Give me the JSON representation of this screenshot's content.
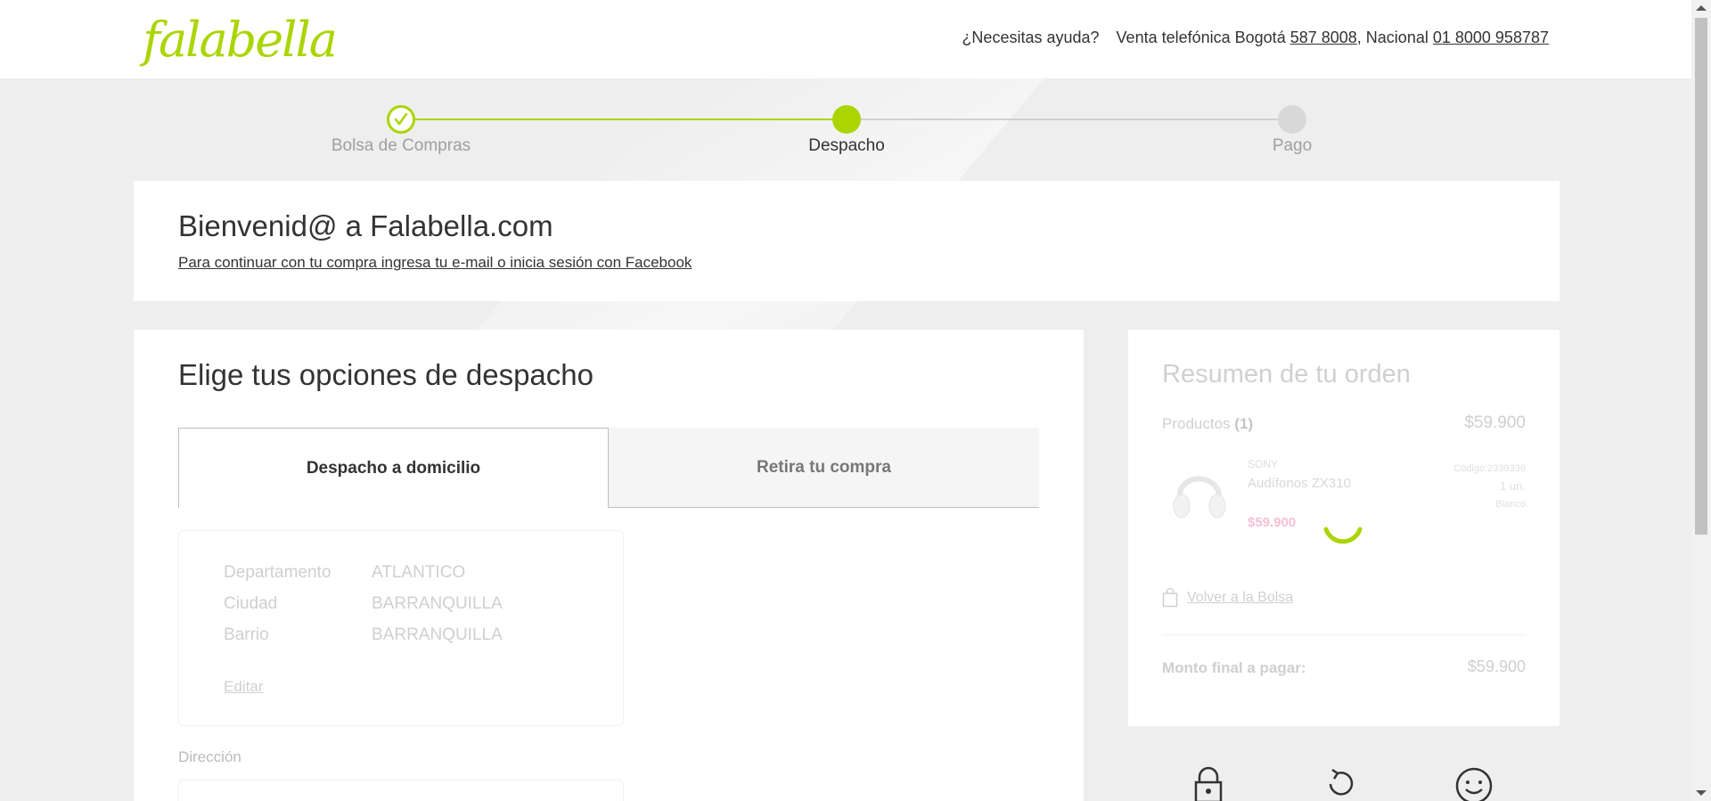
{
  "header": {
    "logo": "falabella",
    "help_question": "¿Necesitas ayuda?",
    "phone_prefix": "Venta telefónica Bogotá",
    "phone_bogota": "587 8008",
    "phone_sep": ", Nacional",
    "phone_national": "01 8000 958787"
  },
  "stepper": {
    "steps": [
      {
        "label": "Bolsa de Compras",
        "state": "done"
      },
      {
        "label": "Despacho",
        "state": "active"
      },
      {
        "label": "Pago",
        "state": "pending"
      }
    ],
    "accent": "#aad500"
  },
  "welcome": {
    "title": "Bienvenid@ a Falabella.com",
    "link": "Para continuar con tu compra ingresa tu e-mail o inicia sesión con Facebook"
  },
  "shipping": {
    "title": "Elige tus opciones de despacho",
    "tabs": [
      {
        "label": "Despacho a domicilio",
        "active": true
      },
      {
        "label": "Retira tu compra",
        "active": false
      }
    ],
    "address": {
      "rows": [
        {
          "key": "Departamento",
          "value": "ATLANTICO"
        },
        {
          "key": "Ciudad",
          "value": "BARRANQUILLA"
        },
        {
          "key": "Barrio",
          "value": "BARRANQUILLA"
        }
      ],
      "edit": "Editar"
    },
    "direccion_label": "Dirección"
  },
  "summary": {
    "title": "Resumen de tu orden",
    "products_label": "Productos",
    "products_count": "(1)",
    "products_total": "$59.900",
    "product": {
      "brand": "SONY",
      "name": "Audífonos ZX310",
      "price": "$59.900",
      "code": "Código:2339336",
      "qty": "1 un.",
      "color": "Blanco"
    },
    "back_to_bag": "Volver a la Bolsa",
    "final_label": "Monto final a pagar:",
    "final_value": "$59.900"
  },
  "icons": {
    "check": "check-icon",
    "bag": "shopping-bag-icon",
    "lock": "lock-icon",
    "refresh": "refresh-icon",
    "smile": "smile-icon"
  }
}
